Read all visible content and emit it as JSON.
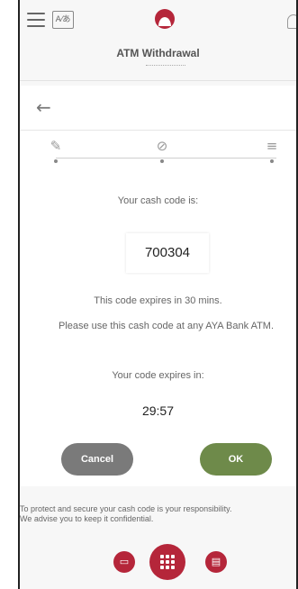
{
  "header": {
    "title": "ATM Withdrawal",
    "language_icon": "translate-icon",
    "menu_icon": "hamburger-menu-icon",
    "notification_icon": "bell-icon",
    "brand_color": "#b5263a"
  },
  "navigation": {
    "back_icon": "arrow-left-icon",
    "back_glyph": "←"
  },
  "stepper": {
    "steps": [
      {
        "icon": "pencil-icon",
        "glyph": "✎"
      },
      {
        "icon": "check-circle-icon",
        "glyph": "⊘"
      },
      {
        "icon": "list-arrow-icon",
        "glyph": "≡"
      }
    ]
  },
  "main": {
    "cash_code_label": "Your cash code is:",
    "cash_code": "700304",
    "expiry_note": "This code expires in 30 mins.",
    "instruction": "Please use this cash code at any AYA Bank ATM.",
    "countdown_label": "Your code expires in:",
    "countdown": "29:57"
  },
  "actions": {
    "cancel_label": "Cancel",
    "ok_label": "OK",
    "cancel_color": "#7a7a7a",
    "ok_color": "#6e8a4a"
  },
  "footer": {
    "note_line1": "To protect and secure your cash code is your responsibility.",
    "note_line2": "We advise you to keep it confidential.",
    "left_fab_icon": "card-icon",
    "main_fab_icon": "grid-menu-icon",
    "right_fab_icon": "document-icon"
  }
}
